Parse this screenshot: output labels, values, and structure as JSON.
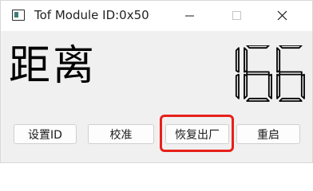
{
  "window": {
    "title": "Tof Module ID:0x50"
  },
  "display": {
    "label": "距离",
    "value": "166"
  },
  "buttons": {
    "settings": "设置ID",
    "calibrate": "校准",
    "factory_reset": "恢复出厂",
    "restart": "重启"
  },
  "colors": {
    "highlight": "#e8201a",
    "background": "#f0f0f0"
  },
  "icons": {
    "app": "window-icon",
    "minimize": "minimize-icon",
    "maximize": "maximize-icon",
    "close": "close-icon"
  }
}
